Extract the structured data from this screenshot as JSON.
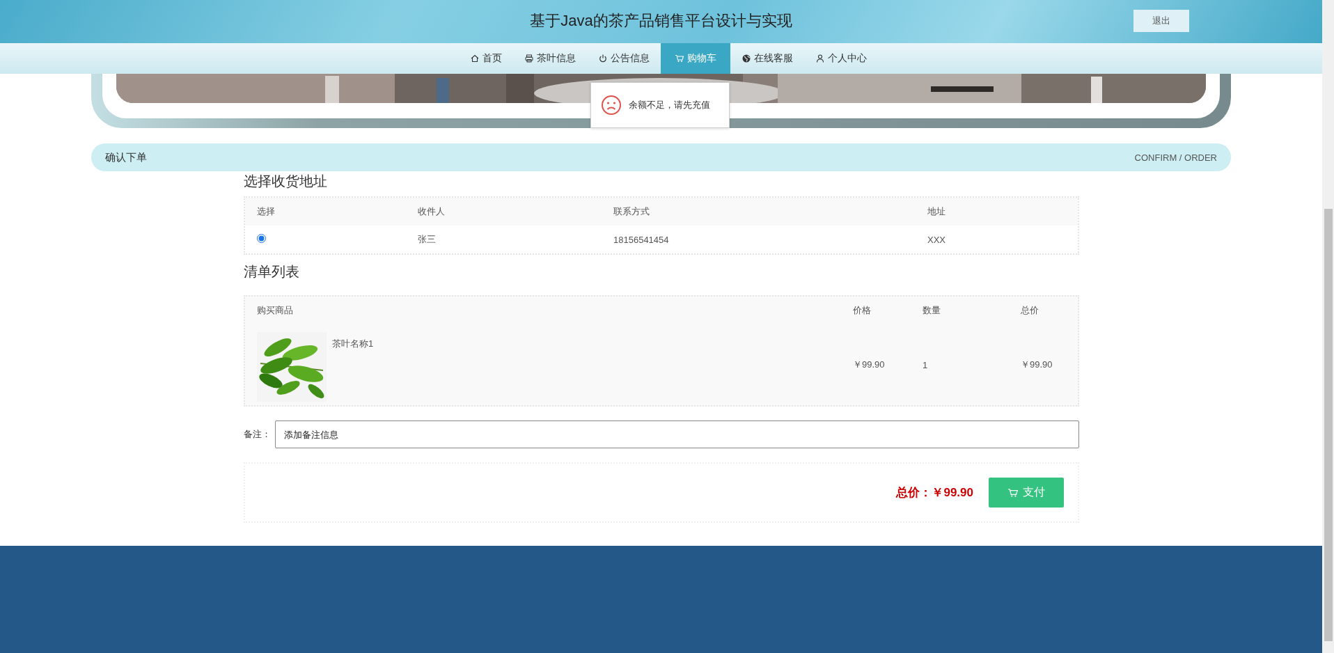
{
  "header": {
    "title": "基于Java的茶产品销售平台设计与实现",
    "logout_button": "退出"
  },
  "nav": [
    {
      "label": "首页",
      "selected": false
    },
    {
      "label": "茶叶信息",
      "selected": false
    },
    {
      "label": "公告信息",
      "selected": false
    },
    {
      "label": "购物车",
      "selected": true
    },
    {
      "label": "在线客服",
      "selected": false
    },
    {
      "label": "个人中心",
      "selected": false
    }
  ],
  "toast": {
    "message": "余额不足，请先充值"
  },
  "section_bar": {
    "title": "确认下单",
    "subtitle": "CONFIRM / ORDER"
  },
  "address_section": {
    "title": "选择收货地址",
    "columns": [
      "选择",
      "收件人",
      "联系方式",
      "地址"
    ],
    "rows": [
      {
        "selected": true,
        "name": "张三",
        "phone": "18156541454",
        "address": "XXX"
      }
    ]
  },
  "order_section": {
    "title": "清单列表",
    "columns": [
      "购买商品",
      "价格",
      "数量",
      "总价"
    ],
    "rows": [
      {
        "product": "茶叶名称1",
        "price": "￥99.90",
        "quantity": "1",
        "total": "￥99.90"
      }
    ]
  },
  "note": {
    "label": "备注：",
    "placeholder": "添加备注信息"
  },
  "summary": {
    "label": "总价：",
    "amount": "￥99.90",
    "pay_button": "支付"
  }
}
